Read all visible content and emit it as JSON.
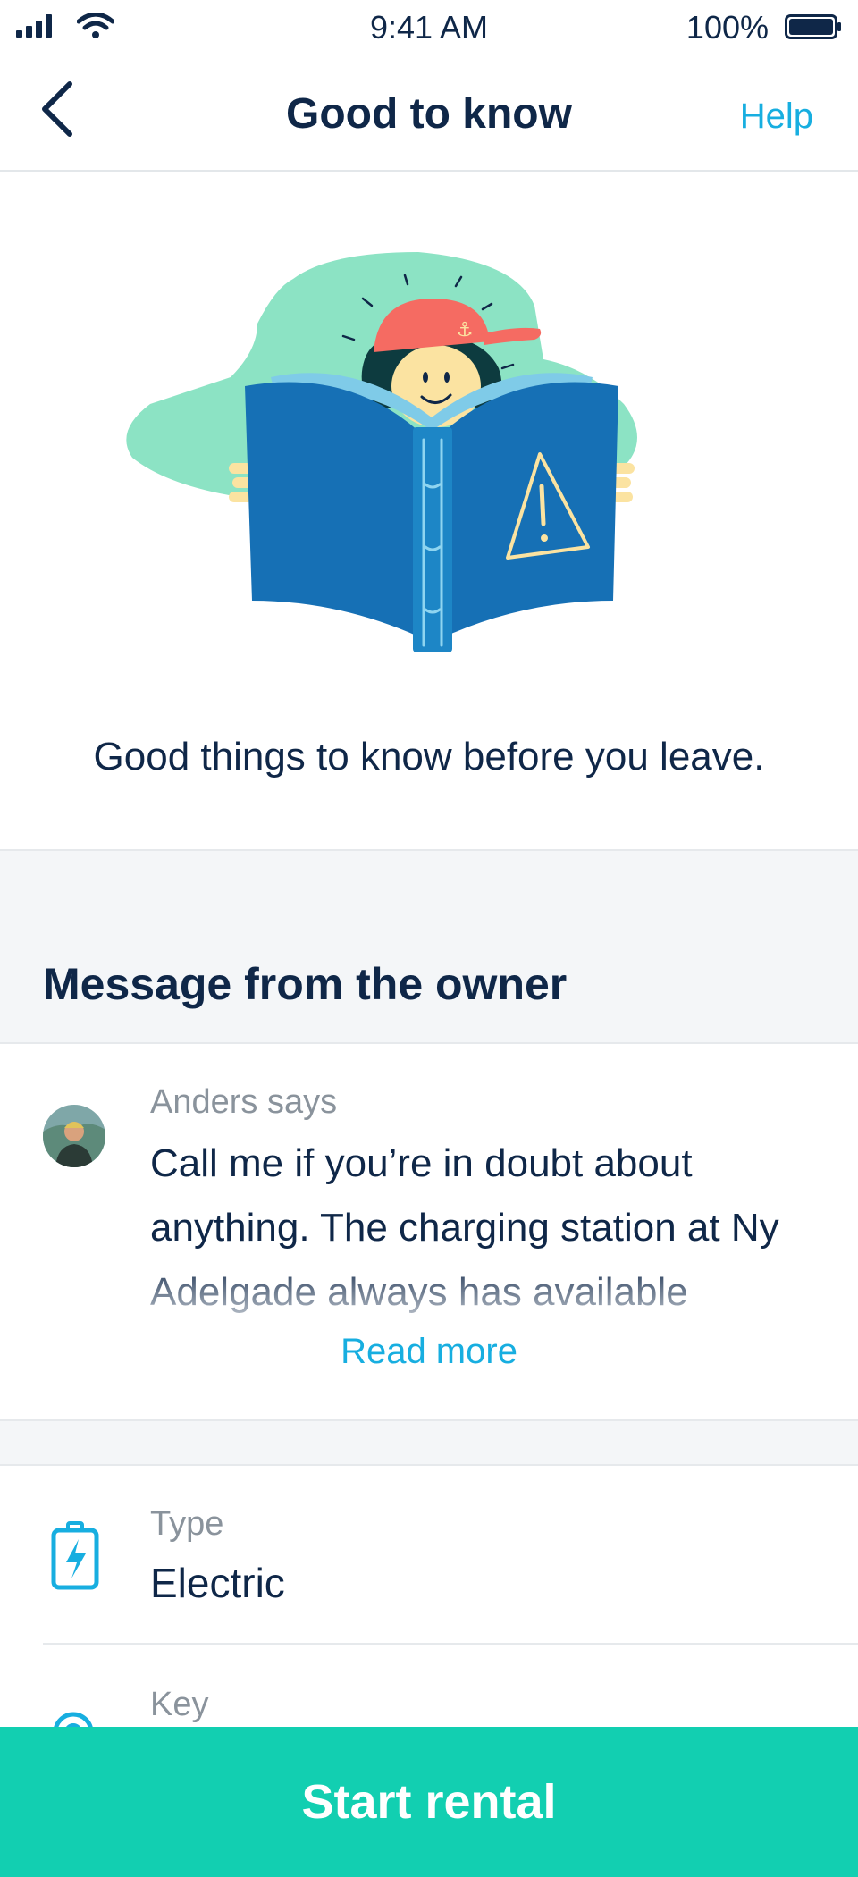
{
  "status_bar": {
    "time": "9:41 AM",
    "battery": "100%"
  },
  "nav": {
    "title": "Good to know",
    "help_label": "Help"
  },
  "hero": {
    "text": "Good things to know before you leave."
  },
  "owner_section": {
    "title": "Message from the owner",
    "author": "Anders says",
    "message": "Call me if you’re in doubt about anything. The charging station at Ny Adelgade always has available",
    "read_more": "Read more"
  },
  "details": [
    {
      "label": "Type",
      "value": "Electric",
      "icon": "battery-bolt-icon"
    },
    {
      "label": "Key",
      "value": "",
      "icon": "key-icon"
    }
  ],
  "cta": {
    "label": "Start rental"
  },
  "colors": {
    "accent": "#17aee0",
    "cta": "#12cfb1",
    "text": "#0f2748",
    "muted": "#8a939c"
  }
}
